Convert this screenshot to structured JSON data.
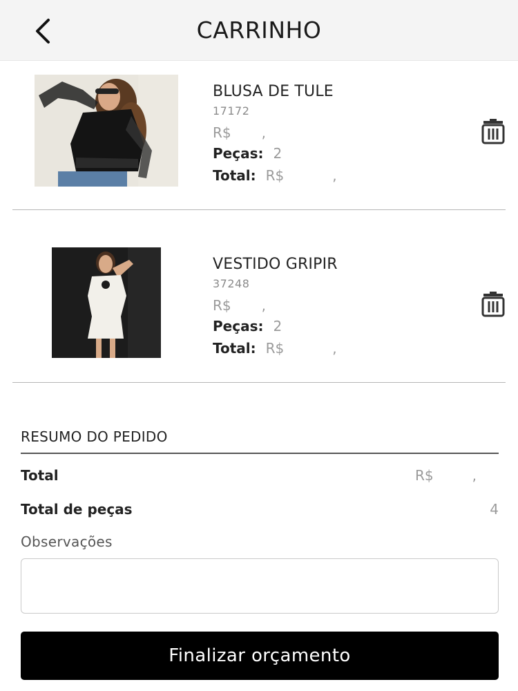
{
  "header": {
    "title": "CARRINHO",
    "back_icon": "chevron-left-icon"
  },
  "items": [
    {
      "name": "BLUSA DE TULE",
      "code": "17172",
      "price_label": "R$",
      "price_sep": ",",
      "qty_label": "Peças:",
      "qty": "2",
      "total_label": "Total:",
      "total_currency": "R$",
      "total_sep": ",",
      "image_desc": "woman in black sheer tulle blouse and jeans",
      "delete_icon": "trash-icon"
    },
    {
      "name": "VESTIDO GRIPIR",
      "code": "37248",
      "price_label": "R$",
      "price_sep": ",",
      "qty_label": "Peças:",
      "qty": "2",
      "total_label": "Total:",
      "total_currency": "R$",
      "total_sep": ",",
      "image_desc": "woman in white short dress against dark background",
      "delete_icon": "trash-icon"
    }
  ],
  "summary": {
    "title": "RESUMO DO PEDIDO",
    "total_label": "Total",
    "total_currency": "R$",
    "total_sep": ",",
    "pieces_label": "Total de peças",
    "pieces_value": "4",
    "obs_label": "Observações",
    "obs_value": ""
  },
  "actions": {
    "finish_label": "Finalizar orçamento"
  },
  "colors": {
    "header_bg": "#f4f4f4",
    "button_bg": "#000000",
    "muted_text": "#9a9a9a"
  }
}
